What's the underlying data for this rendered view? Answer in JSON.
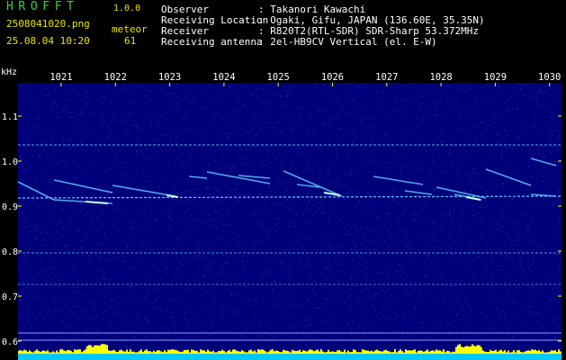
{
  "header": {
    "app_name": "HROFFT",
    "app_version": "1.0.0",
    "file_name": "2508041020.png",
    "datetime": "25.08.04 10:20",
    "meteor_label": "meteor",
    "meteor_count": "61"
  },
  "info": [
    {
      "label": "Observer",
      "value": ": Takanori Kawachi"
    },
    {
      "label": "Receiving Location",
      "value": ": Ogaki, Gifu, JAPAN (136.60E, 35.35N)"
    },
    {
      "label": "Receiver",
      "value": ": R820T2(RTL-SDR) SDR-Sharp 53.372MHz"
    },
    {
      "label": "Receiving antenna",
      "value": ": 2el-HB9CV Vertical (el. E-W)"
    }
  ],
  "spectrogram": {
    "y_unit": "kHz",
    "y_ticks": [
      "1.1",
      "1.0",
      "0.9",
      "0.8",
      "0.7",
      "0.6"
    ],
    "y_values": [
      1.1,
      1.0,
      0.9,
      0.8,
      0.7,
      0.6
    ],
    "x_ticks": [
      "1021",
      "1022",
      "1023",
      "1024",
      "1025",
      "1026",
      "1027",
      "1028",
      "1029",
      "1030"
    ],
    "colors": {
      "background": "#00007a",
      "signal": "#5ec8ff",
      "bright": "#c8ffff",
      "level": "#ffff00",
      "base": "#00c8ff",
      "tick": "#ffff00"
    }
  }
}
